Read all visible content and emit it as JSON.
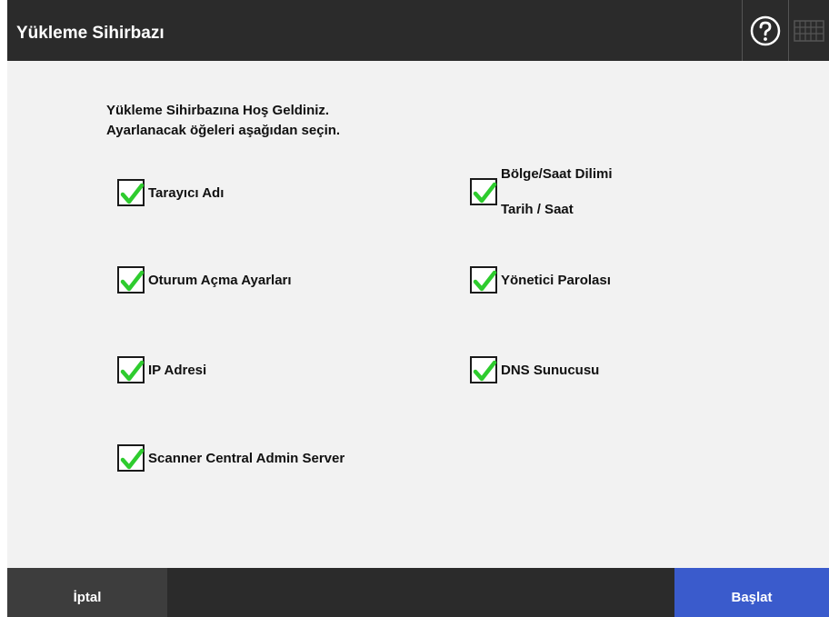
{
  "window": {
    "title": "Yükleme Sihirbazı"
  },
  "header": {
    "help_icon": "help-icon",
    "keyboard_icon": "keyboard-icon"
  },
  "intro": {
    "line1": "Yükleme Sihirbazına Hoş Geldiniz.",
    "line2": "Ayarlanacak öğeleri aşağıdan seçin."
  },
  "options": {
    "scanner_name": {
      "label": "Tarayıcı Adı",
      "checked": true
    },
    "logon_settings": {
      "label": "Oturum Açma Ayarları",
      "checked": true
    },
    "ip_address": {
      "label": "IP Adresi",
      "checked": true
    },
    "scanner_central_admin": {
      "label": "Scanner Central Admin Server",
      "checked": true
    },
    "region_datetime": {
      "label1": "Bölge/Saat Dilimi",
      "label2": "Tarih / Saat",
      "checked": true
    },
    "admin_password": {
      "label": "Yönetici Parolası",
      "checked": true
    },
    "dns_server": {
      "label": "DNS Sunucusu",
      "checked": true
    }
  },
  "footer": {
    "cancel_label": "İptal",
    "start_label": "Başlat"
  },
  "colors": {
    "bar": "#2b2b2b",
    "accent": "#3a5bcc",
    "check": "#2ecc2e"
  }
}
